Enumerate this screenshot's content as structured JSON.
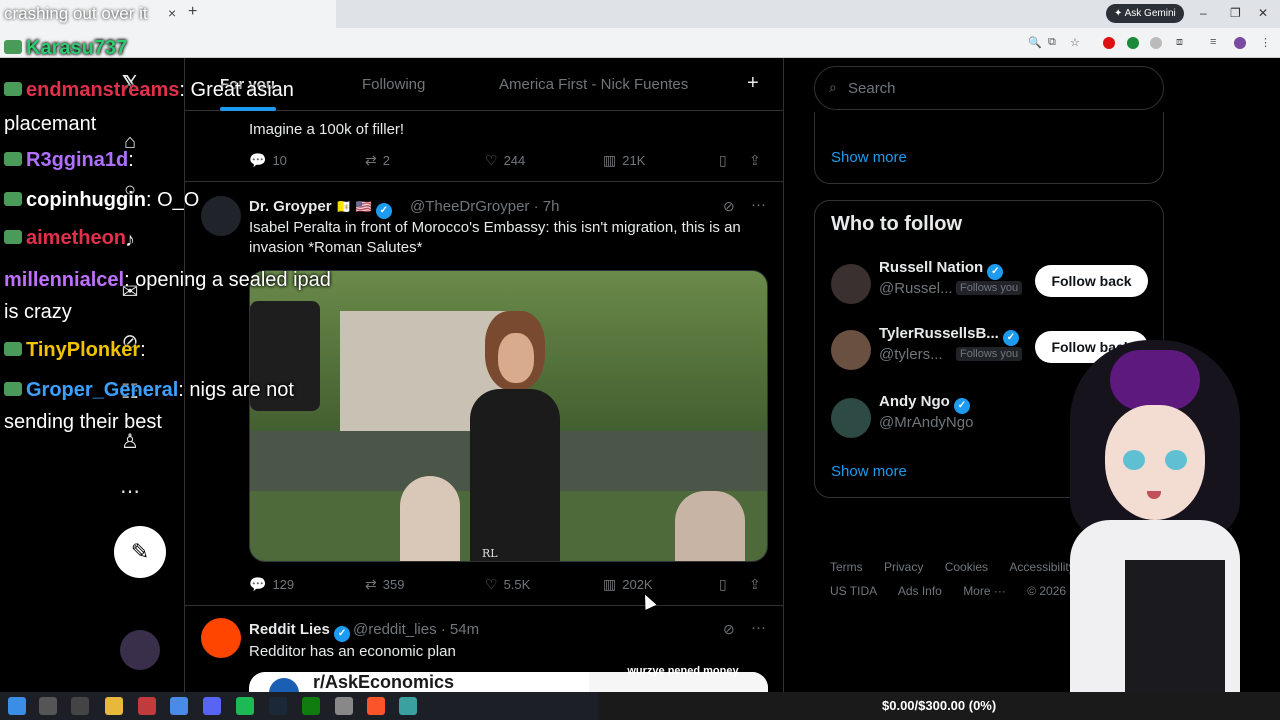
{
  "stream": {
    "title": "crashing out over it"
  },
  "browser": {
    "ask_gemini": "Ask Gemini"
  },
  "tabs": {
    "for_you": "For you",
    "following": "Following",
    "custom": "America First - Nick Fuentes"
  },
  "chat": [
    {
      "user": "Karasu737",
      "color": "#2ecc71",
      "msg": ""
    },
    {
      "user": "endmanstreams",
      "color": "#e0304a",
      "msg": ": Great asian"
    },
    {
      "user": "",
      "color": "#ffffff",
      "msg": "placemant"
    },
    {
      "user": "R3ggina1d",
      "color": "#b070ff",
      "msg": ":"
    },
    {
      "user": "copinhuggin",
      "color": "#ffffff",
      "msg": ": O_O"
    },
    {
      "user": "aimetheon",
      "color": "#e0304a",
      "msg": ""
    },
    {
      "user": "millennialcel",
      "color": "#c070ff",
      "msg": ": opening a sealed ipad"
    },
    {
      "user": "",
      "color": "#ffffff",
      "msg": "is crazy"
    },
    {
      "user": "TinyPlonker",
      "color": "#f2c200",
      "msg": ":"
    },
    {
      "user": "Groper_General",
      "color": "#3ca0ff",
      "msg": ": nigs are not"
    },
    {
      "user": "",
      "color": "#ffffff",
      "msg": "sending their best"
    }
  ],
  "posts": [
    {
      "text": "Imagine a 100k of filler!",
      "replies": "10",
      "reposts": "2",
      "likes": "244",
      "views": "21K"
    },
    {
      "name": "Dr. Groyper",
      "flags": "🇻🇦 🇺🇸",
      "handle": "@TheeDrGroyper · 7h",
      "text": "Isabel Peralta in front of Morocco's Embassy: this isn't migration, this is an invasion *Roman Salutes*",
      "media_watermark": "RL",
      "replies": "129",
      "reposts": "359",
      "likes": "5.5K",
      "views": "202K"
    },
    {
      "name": "Reddit Lies",
      "handle": "@reddit_lies · 54m",
      "text": "Redditor has an economic plan",
      "card_title": "r/AskEconomics",
      "card_right": "wurzye nened money"
    }
  ],
  "sidebar": {
    "search_placeholder": "Search",
    "show_more": "Show more",
    "who_to_follow": "Who to follow",
    "follows_you": "Follows you",
    "follow_back": "Follow back",
    "accounts": [
      {
        "name": "Russell Nation",
        "handle": "@Russel...",
        "follows_you": true
      },
      {
        "name": "TylerRussellsB...",
        "handle": "@tylers...",
        "follows_you": true
      },
      {
        "name": "Andy Ngo",
        "handle": "@MrAndyNgo",
        "follows_you": false
      }
    ],
    "footer": {
      "terms": "Terms",
      "privacy": "Privacy",
      "cookies": "Cookies",
      "accessibility": "Accessibility",
      "ads": "US TIDA",
      "ads_info": "Ads Info",
      "more": "More ···",
      "copyright": "© 2026"
    }
  },
  "overlay": {
    "donation_goal": "$0.00/$300.00 (0%)"
  }
}
